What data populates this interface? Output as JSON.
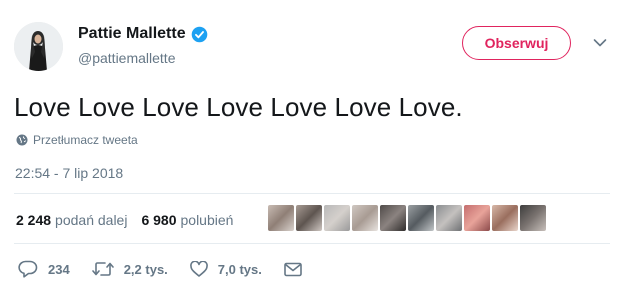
{
  "author": {
    "name": "Pattie Mallette",
    "handle": "@pattiemallette"
  },
  "follow_label": "Obserwuj",
  "tweet": {
    "text": "Love Love Love Love Love Love Love.",
    "translate_label": "Przetłumacz tweeta",
    "timestamp": "22:54 - 7 lip 2018"
  },
  "stats": {
    "retweets_count": "2 248",
    "retweets_label": "podań dalej",
    "likes_count": "6 980",
    "likes_label": "polubień"
  },
  "actions": {
    "reply_count": "234",
    "retweet_count": "2,2 tys.",
    "like_count": "7,0 tys."
  },
  "colors": {
    "accent": "#e0245e",
    "verified": "#1da1f2",
    "muted": "#657786",
    "text": "#14171a"
  },
  "icons": [
    "verified-badge-icon",
    "chevron-down-icon",
    "globe-icon",
    "reply-icon",
    "retweet-icon",
    "heart-icon",
    "message-icon"
  ]
}
